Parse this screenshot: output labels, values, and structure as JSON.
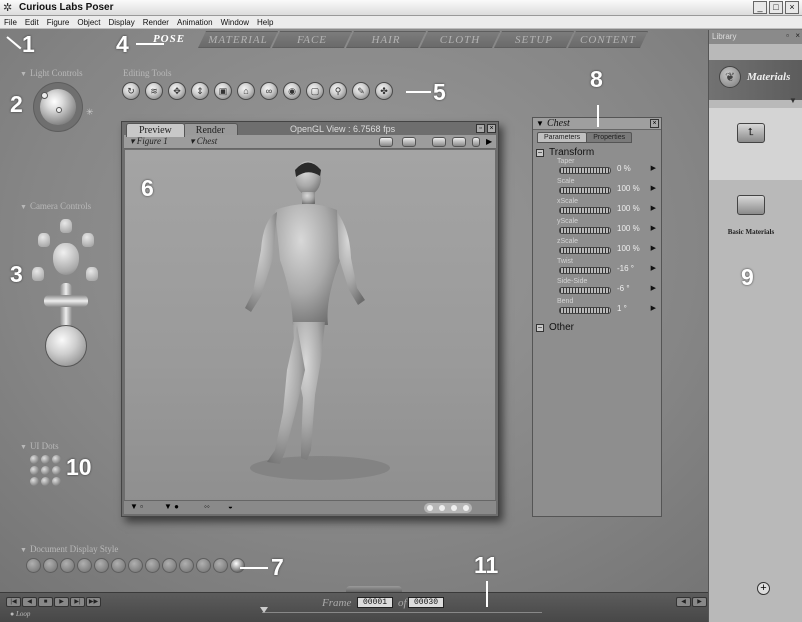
{
  "window": {
    "title": "Curious Labs Poser",
    "buttons": [
      "_",
      "□",
      "×"
    ]
  },
  "menu": [
    "File",
    "Edit",
    "Figure",
    "Object",
    "Display",
    "Render",
    "Animation",
    "Window",
    "Help"
  ],
  "rooms": {
    "active": "POSE",
    "tabs": [
      "MATERIAL",
      "FACE",
      "HAIR",
      "CLOTH",
      "SETUP",
      "CONTENT"
    ]
  },
  "sections": {
    "light_controls": "Light Controls",
    "editing_tools": "Editing Tools",
    "camera_controls": "Camera Controls",
    "ui_dots": "UI Dots",
    "doc_display_style": "Document Display Style"
  },
  "editing_tools": [
    "rotate",
    "twist",
    "translate",
    "translate-in-out",
    "scale",
    "taper",
    "chain-break",
    "color",
    "grouping",
    "view-magnifier",
    "morphing",
    "direct-manipulation"
  ],
  "document": {
    "tabs": [
      "Preview",
      "Render"
    ],
    "active_tab": "Preview",
    "fps": "OpenGL View : 6.7568 fps",
    "figure_select": "Figure 1",
    "part_select": "Chest"
  },
  "parameters": {
    "title": "Chest",
    "tabs": [
      "Parameters",
      "Properties"
    ],
    "active_tab": "Parameters",
    "groups": {
      "transform": "Transform",
      "other": "Other"
    },
    "rows": [
      {
        "name": "Taper",
        "value": "0 %"
      },
      {
        "name": "Scale",
        "value": "100 %"
      },
      {
        "name": "xScale",
        "value": "100 %"
      },
      {
        "name": "yScale",
        "value": "100 %"
      },
      {
        "name": "zScale",
        "value": "100 %"
      },
      {
        "name": "Twist",
        "value": "-16 °"
      },
      {
        "name": "Side-Side",
        "value": "-6 °"
      },
      {
        "name": "Bend",
        "value": "1 °"
      }
    ]
  },
  "library": {
    "title": "Library",
    "category": "Materials",
    "items": [
      {
        "icon": "up-folder",
        "label": ""
      },
      {
        "icon": "folder",
        "label": "Basic Materials"
      }
    ]
  },
  "animation": {
    "frame_label": "Frame",
    "current_frame": "00001",
    "of_label": "of",
    "total_frames": "00030",
    "loop_label": "Loop"
  },
  "callouts": [
    "1",
    "2",
    "3",
    "4",
    "5",
    "6",
    "7",
    "8",
    "9",
    "10",
    "11"
  ]
}
